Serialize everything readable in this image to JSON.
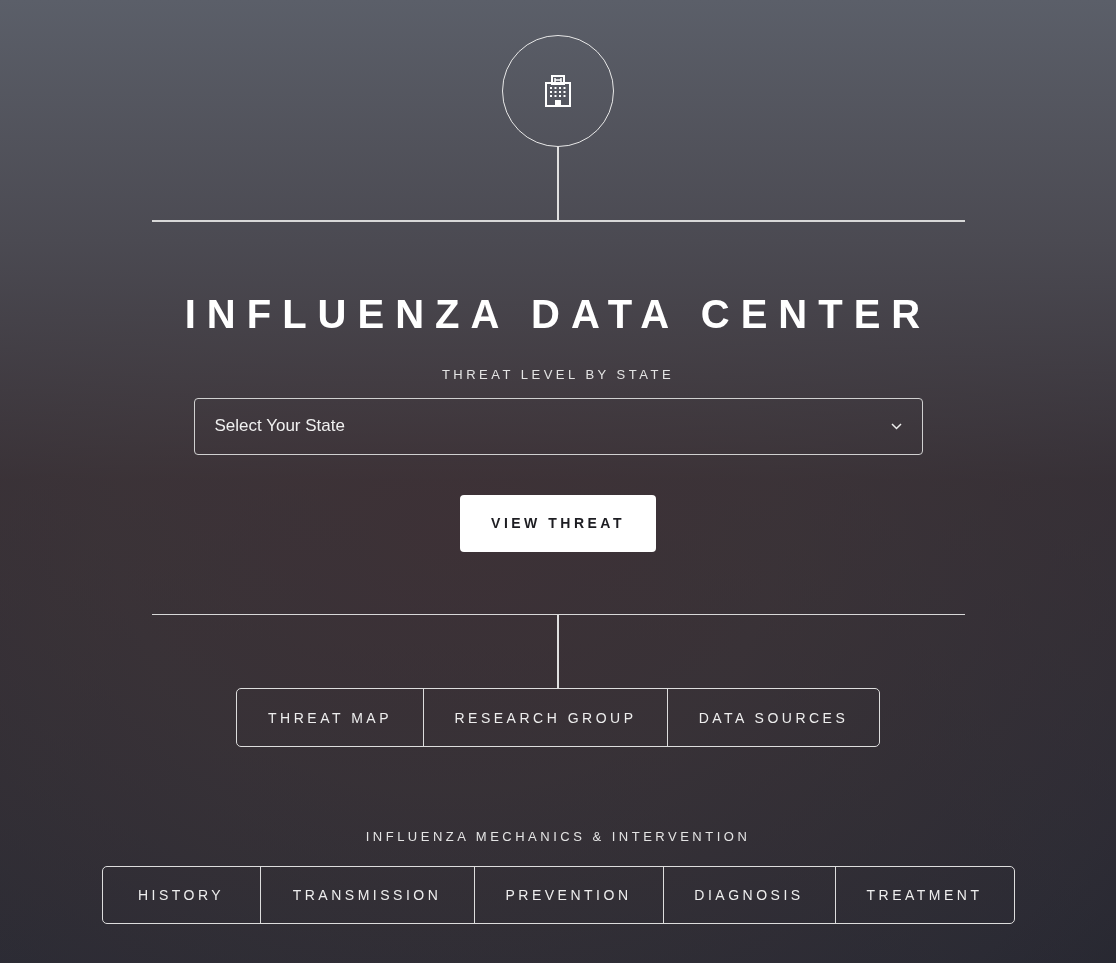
{
  "title": "INFLUENZA DATA CENTER",
  "subtitle": "THREAT LEVEL BY STATE",
  "state_select": {
    "placeholder": "Select Your State"
  },
  "view_button": "VIEW THREAT",
  "links": [
    "THREAT MAP",
    "RESEARCH GROUP",
    "DATA SOURCES"
  ],
  "section_title": "INFLUENZA MECHANICS & INTERVENTION",
  "topics": [
    "HISTORY",
    "TRANSMISSION",
    "PREVENTION",
    "DIAGNOSIS",
    "TREATMENT"
  ]
}
